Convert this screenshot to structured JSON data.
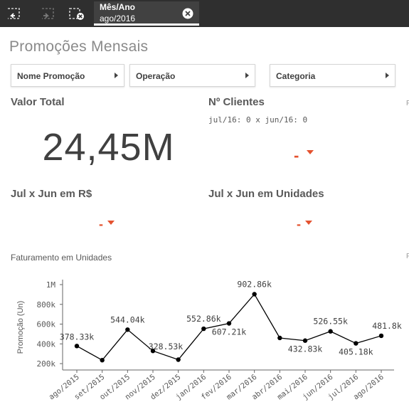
{
  "toolbar": {
    "back_icon": "step-back-icon",
    "forward_icon": "step-forward-icon",
    "clear_all_icon": "clear-selections-icon"
  },
  "selection": {
    "field": "Mês/Ano",
    "value": "ago/2016"
  },
  "sheet": {
    "title": "Promoções Mensais"
  },
  "filters": [
    {
      "label": "Nome Promoção"
    },
    {
      "label": "Operação"
    },
    {
      "label": "Categoria"
    }
  ],
  "kpis": {
    "valor_total": {
      "title": "Valor Total",
      "value": "24,45M"
    },
    "n_clientes": {
      "title": "Nº Clientes",
      "subtitle": "jul/16: 0 x jun/16: 0",
      "value": "-"
    },
    "jul_jun_rs": {
      "title": "Jul x Jun em R$",
      "value": "-"
    },
    "jul_jun_un": {
      "title": "Jul x Jun em Unidades",
      "value": "-"
    }
  },
  "edge_labels": {
    "top": "F",
    "mid": "F"
  },
  "colors": {
    "toolbar_bg": "#2f2f2f",
    "negative_indicator": "#e4522f",
    "line": "#000000"
  },
  "chart_data": {
    "type": "line",
    "title": "Faturamento em Unidades",
    "ylabel": "Promoção (Un)",
    "xlabel": "",
    "categories": [
      "ago/2015",
      "set/2015",
      "out/2015",
      "nov/2015",
      "dez/2015",
      "jan/2016",
      "fev/2016",
      "mar/2016",
      "abr/2016",
      "mai/2016",
      "jun/2016",
      "jul/2016",
      "ago/2016"
    ],
    "values": [
      378330,
      235000,
      544040,
      328530,
      240000,
      552860,
      607210,
      902860,
      460000,
      432830,
      526550,
      405180,
      481800
    ],
    "data_labels": [
      "378.33k",
      null,
      "544.04k",
      "328.53k",
      null,
      "552.86k",
      "607.21k",
      "902.86k",
      null,
      "432.83k",
      "526.55k",
      "405.18k",
      "481.8k"
    ],
    "yticks": [
      {
        "v": 200000,
        "label": "200k"
      },
      {
        "v": 400000,
        "label": "400k"
      },
      {
        "v": 600000,
        "label": "600k"
      },
      {
        "v": 800000,
        "label": "800k"
      },
      {
        "v": 1000000,
        "label": "1M"
      }
    ],
    "ylim": [
      150000,
      1000000
    ],
    "grid": false
  }
}
